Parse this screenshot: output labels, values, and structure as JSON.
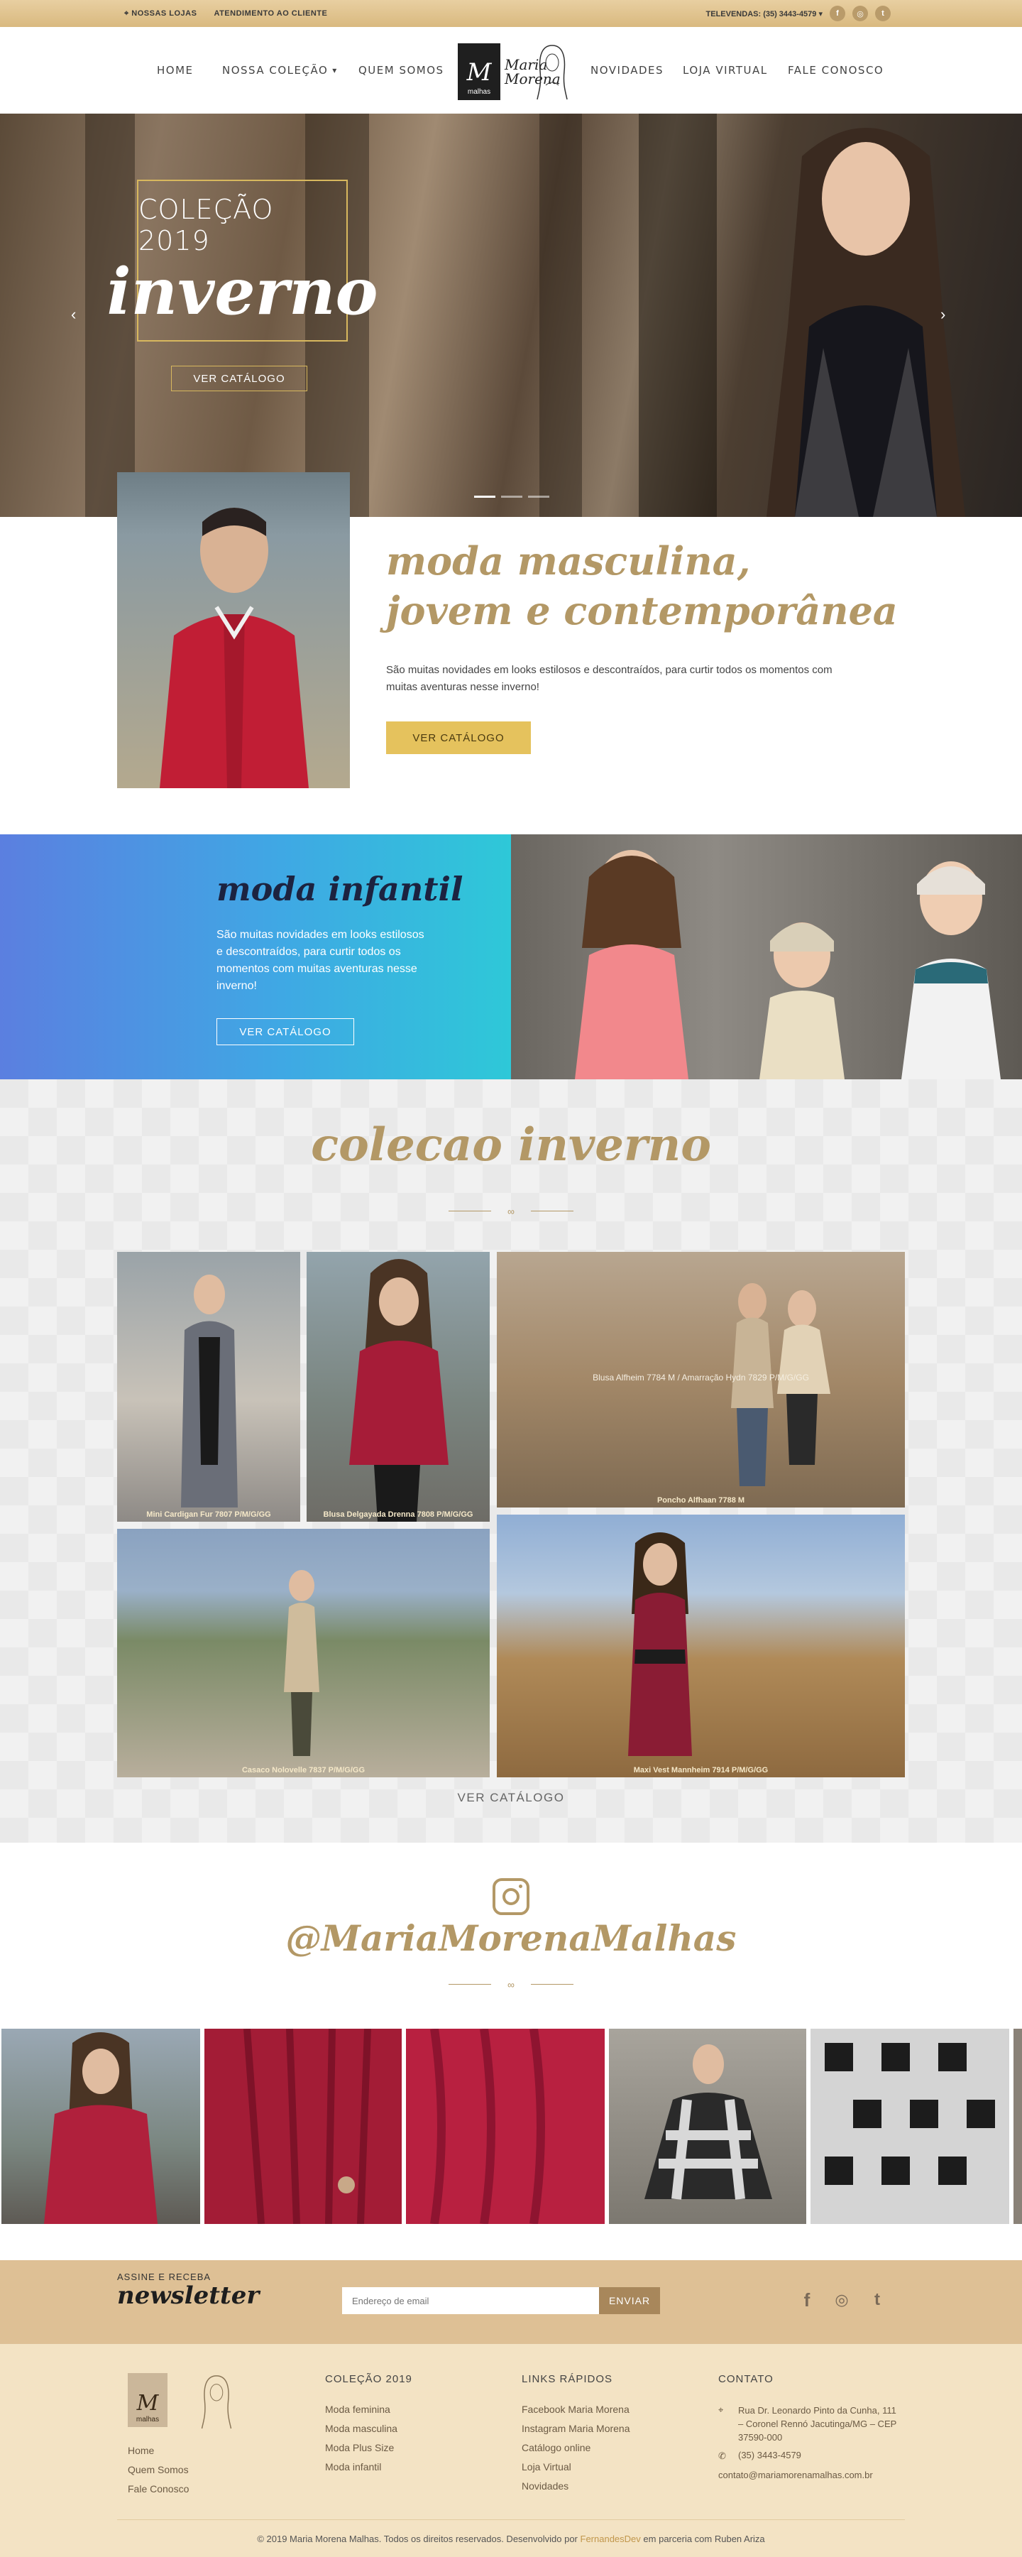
{
  "topbar": {
    "stores_label": "NOSSAS LOJAS",
    "service_label": "ATENDIMENTO AO CLIENTE",
    "phone_label": "TELEVENDAS: (35) 3443-4579 ▾"
  },
  "nav": {
    "home": "HOME",
    "colecao": "NOSSA COLEÇÃO",
    "quem": "QUEM SOMOS",
    "novidades": "NOVIDADES",
    "loja": "LOJA VIRTUAL",
    "fale": "FALE CONOSCO",
    "logo_line1": "Maria",
    "logo_line2": "Morena",
    "logo_sub": "malhas",
    "logo_mono": "M"
  },
  "hero": {
    "line1": "COLEÇÃO 2019",
    "line2": "inverno",
    "button": "VER CATÁLOGO"
  },
  "masculina": {
    "title_line1": "moda masculina,",
    "title_line2": "jovem e contemporânea",
    "text": "São muitas novidades em looks estilosos e descontraídos, para curtir todos os momentos com muitas aventuras nesse inverno!",
    "button": "VER CATÁLOGO"
  },
  "infantil": {
    "title": "moda infantil",
    "text": "São muitas novidades em looks estilosos e descontraídos, para curtir todos os momentos com muitas aventuras nesse inverno!",
    "button": "VER CATÁLOGO"
  },
  "colecao": {
    "title": "colecao inverno",
    "captions": [
      "Mini Cardigan Fur 7807 P/M/G/GG",
      "Blusa Delgayada Drenna 7808 P/M/G/GG",
      "Poncho Alfhaan 7788 M",
      "Casaco Nolovelle 7837 P/M/G/GG",
      "Maxi Vest Mannheim 7914 P/M/G/GG"
    ],
    "overlay_text": "Blusa Alfheim 7784 M / Amarração Hydn 7829 P/M/G/GG",
    "ver_catalogo": "VER CATÁLOGO"
  },
  "instagram": {
    "handle": "@MariaMorenaMalhas"
  },
  "newsletter": {
    "small": "ASSINE E RECEBA",
    "big": "newsletter",
    "placeholder": "Endereço de email",
    "button": "ENVIAR"
  },
  "footer": {
    "about_links": [
      "Home",
      "Quem Somos",
      "Fale Conosco"
    ],
    "colecao_title": "COLEÇÃO 2019",
    "colecao_links": [
      "Moda feminina",
      "Moda masculina",
      "Moda Plus Size",
      "Moda infantil"
    ],
    "links_title": "LINKS RÁPIDOS",
    "quick_links": [
      "Facebook Maria Morena",
      "Instagram Maria Morena",
      "Catálogo online",
      "Loja Virtual",
      "Novidades"
    ],
    "contact_title": "CONTATO",
    "address": "Rua Dr. Leonardo Pinto da Cunha, 111 – Coronel Rennó Jacutinga/MG – CEP 37590-000",
    "phone": "(35) 3443-4579",
    "email": "contato@mariamorenamalhas.com.br",
    "copy_pre": "© 2019 Maria Morena Malhas. Todos os direitos reservados. Desenvolvido por",
    "copy_dev": "FernandesDev",
    "copy_post": "em parceria com Ruben Ariza"
  },
  "colors": {
    "gold": "#b39866",
    "topbar": "#d9b97f",
    "button_yellow": "#e5c25d",
    "footer_bg": "#f3e3c4",
    "newsletter_bg": "#dec095"
  },
  "icons": [
    "map-pin-icon",
    "facebook-icon",
    "instagram-icon",
    "twitter-icon",
    "chevron-down-icon",
    "arrow-left-icon",
    "arrow-right-icon",
    "phone-icon",
    "location-icon"
  ]
}
